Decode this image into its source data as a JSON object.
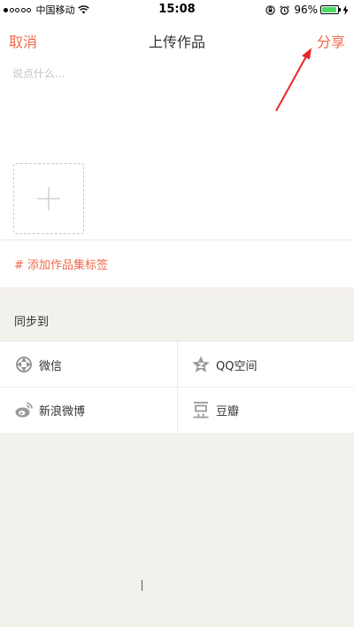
{
  "status_bar": {
    "carrier": "中国移动",
    "time": "15:08",
    "battery_percent": "96%",
    "battery_level": 0.96,
    "wifi_icon": "wifi-icon",
    "orientation_lock_icon": "orientation-lock-icon",
    "alarm_icon": "alarm-icon"
  },
  "nav": {
    "cancel": "取消",
    "title": "上传作品",
    "share": "分享"
  },
  "compose": {
    "placeholder": "说点什么...",
    "value": "",
    "add_photo_icon": "plus-icon",
    "tag_link": "# 添加作品集标签"
  },
  "sync": {
    "label": "同步到",
    "items": [
      {
        "label": "微信",
        "icon": "wechat-icon"
      },
      {
        "label": "QQ空间",
        "icon": "qzone-icon"
      },
      {
        "label": "新浪微博",
        "icon": "weibo-icon"
      },
      {
        "label": "豆瓣",
        "icon": "douban-icon"
      }
    ]
  },
  "colors": {
    "accent": "#f16a4b",
    "background": "#f3f1ec",
    "annotation": "#e8262b"
  }
}
